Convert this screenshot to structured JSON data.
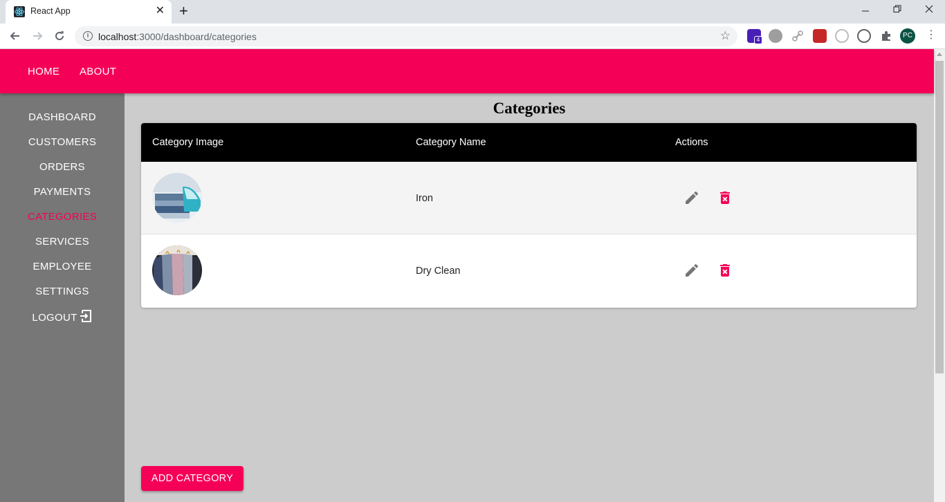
{
  "browser": {
    "tab_title": "React App",
    "tab_close": "✕",
    "new_tab": "+",
    "url_host": "localhost",
    "url_rest": ":3000/dashboard/categories",
    "profile_initials": "PC",
    "extension_badge": "4"
  },
  "appbar": {
    "home": "HOME",
    "about": "ABOUT"
  },
  "sidebar": {
    "items": [
      {
        "label": "DASHBOARD"
      },
      {
        "label": "CUSTOMERS"
      },
      {
        "label": "ORDERS"
      },
      {
        "label": "PAYMENTS"
      },
      {
        "label": "CATEGORIES",
        "active": true
      },
      {
        "label": "SERVICES"
      },
      {
        "label": "EMPLOYEE"
      },
      {
        "label": "SETTINGS"
      },
      {
        "label": "LOGOUT",
        "icon": "logout-icon"
      }
    ]
  },
  "main": {
    "title": "Categories",
    "table": {
      "columns": [
        "Category Image",
        "Category Name",
        "Actions"
      ],
      "rows": [
        {
          "name": "Iron",
          "image": "iron-clothes-image"
        },
        {
          "name": "Dry Clean",
          "image": "shirts-on-hangers-image"
        }
      ]
    },
    "add_button": "ADD CATEGORY"
  },
  "colors": {
    "accent": "#f50057",
    "sidebar": "#777777",
    "content_bg": "#cccccc",
    "table_header": "#000000"
  }
}
